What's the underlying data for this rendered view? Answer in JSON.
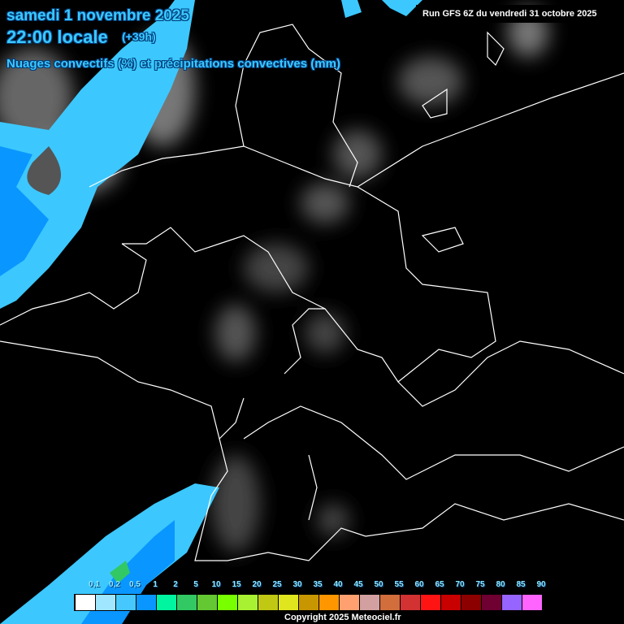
{
  "header": {
    "date": "samedi 1 novembre 2025",
    "time": "22:00 locale",
    "lead": "(+39h)",
    "parameter": "Nuages convectifs (%) et précipitations convectives (mm)",
    "run": "Run GFS 6Z du vendredi 31 octobre 2025"
  },
  "legend": {
    "labels": [
      "0,1",
      "0,2",
      "0,5",
      "1",
      "2",
      "5",
      "10",
      "15",
      "20",
      "25",
      "30",
      "35",
      "40",
      "45",
      "50",
      "55",
      "60",
      "65",
      "70",
      "75",
      "80",
      "85",
      "90"
    ],
    "colors": [
      "#ffffff",
      "#a0e6ff",
      "#46c8ff",
      "#0a96ff",
      "#00f5a0",
      "#32c864",
      "#64c832",
      "#78ff00",
      "#a8f032",
      "#c0c814",
      "#e0e61e",
      "#c89600",
      "#ff9600",
      "#ffa070",
      "#d2a0a0",
      "#d26e3c",
      "#d23232",
      "#ff1414",
      "#c80000",
      "#8c0000",
      "#6e0032",
      "#9664ff",
      "#ff64ff"
    ]
  },
  "footer": {
    "copyright": "Copyright 2025 Meteociel.fr"
  }
}
